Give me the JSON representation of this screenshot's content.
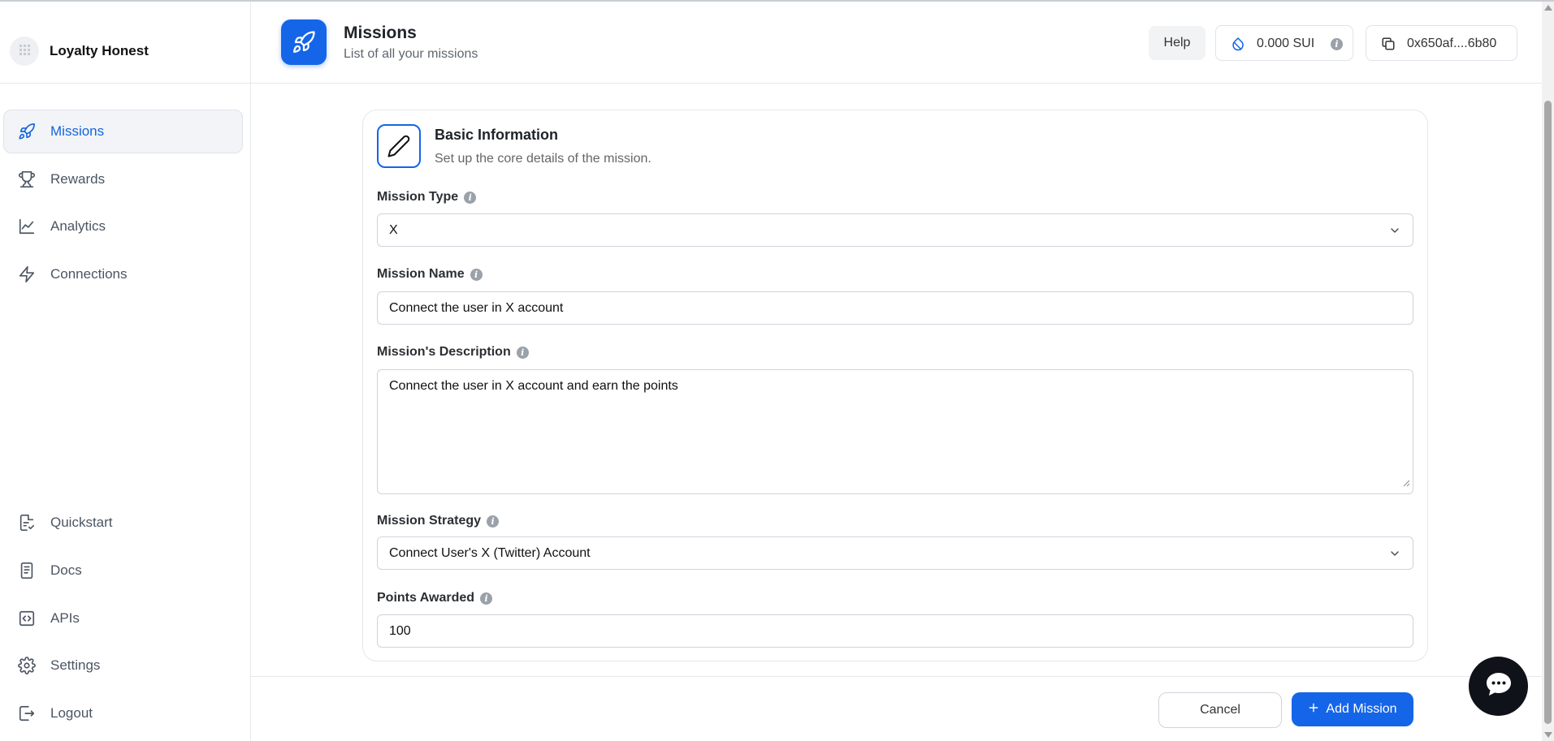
{
  "app": {
    "name": "Loyalty Honest"
  },
  "sidebar": {
    "items": [
      {
        "label": "Missions",
        "icon": "rocket-icon",
        "active": true
      },
      {
        "label": "Rewards",
        "icon": "trophy-icon"
      },
      {
        "label": "Analytics",
        "icon": "line-chart-icon"
      },
      {
        "label": "Connections",
        "icon": "lightning-icon"
      }
    ],
    "bottom_items": [
      {
        "label": "Quickstart",
        "icon": "checklist-icon"
      },
      {
        "label": "Docs",
        "icon": "document-icon"
      },
      {
        "label": "APIs",
        "icon": "code-icon"
      },
      {
        "label": "Settings",
        "icon": "gear-icon"
      },
      {
        "label": "Logout",
        "icon": "logout-icon"
      }
    ]
  },
  "header": {
    "title": "Missions",
    "subtitle": "List of all your missions",
    "help_label": "Help",
    "balance": "0.000 SUI",
    "wallet": "0x650af....6b80"
  },
  "form": {
    "section_title": "Basic Information",
    "section_subtitle": "Set up the core details of the mission.",
    "mission_type": {
      "label": "Mission Type",
      "value": "X"
    },
    "mission_name": {
      "label": "Mission Name",
      "value": "Connect the user in X account"
    },
    "description": {
      "label": "Mission's Description",
      "value": "Connect the user in X account and earn the points"
    },
    "strategy": {
      "label": "Mission Strategy",
      "value": "Connect User's X (Twitter) Account"
    },
    "points": {
      "label": "Points Awarded",
      "value": "100"
    }
  },
  "footer": {
    "cancel_label": "Cancel",
    "add_label": "Add Mission"
  },
  "colors": {
    "accent": "#1565e8",
    "active_text": "#1565d8",
    "chat_bubble": "#0f1218"
  }
}
